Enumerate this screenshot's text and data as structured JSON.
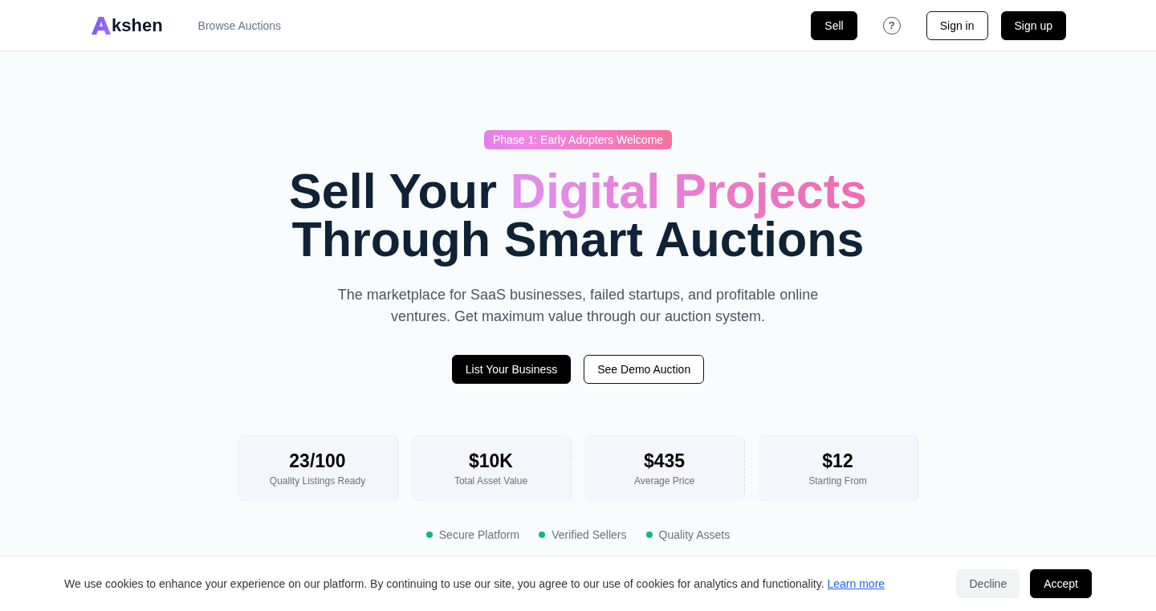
{
  "nav": {
    "logo_text": "kshen",
    "links": [
      "Browse Auctions"
    ],
    "sell": "Sell",
    "help": "?",
    "sign_in": "Sign in",
    "sign_up": "Sign up"
  },
  "hero": {
    "badge": "Phase 1: Early Adopters Welcome",
    "title_lead": "Sell Your ",
    "title_highlight": "Digital Projects",
    "title_tail": "Through Smart Auctions",
    "subtitle": "The marketplace for SaaS businesses, failed startups, and profitable online ventures. Get maximum value through our auction system.",
    "primary": "List Your Business",
    "secondary": "See Demo Auction"
  },
  "stats": [
    {
      "value": "23/100",
      "label": "Quality Listings Ready"
    },
    {
      "value": "$10K",
      "label": "Total Asset Value"
    },
    {
      "value": "$435",
      "label": "Average Price"
    },
    {
      "value": "$12",
      "label": "Starting From"
    }
  ],
  "features": [
    {
      "label": "Secure Platform",
      "color": "#10b981"
    },
    {
      "label": "Verified Sellers",
      "color": "#10b981"
    },
    {
      "label": "Quality Assets",
      "color": "#10b981"
    }
  ],
  "cookie": {
    "text": "We use cookies to enhance your experience on our platform. By continuing to use our site, you agree to our use of cookies for analytics and functionality.",
    "link": "Learn more",
    "decline": "Decline",
    "accept": "Accept"
  }
}
